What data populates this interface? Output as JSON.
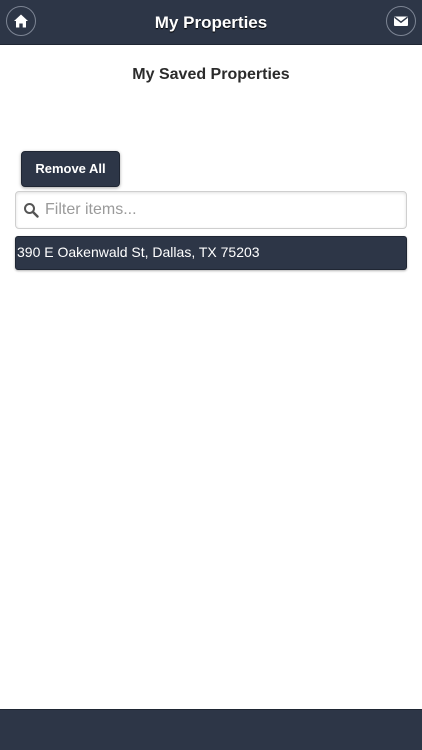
{
  "header": {
    "title": "My Properties",
    "left_icon": "home-icon",
    "right_icon": "mail-icon"
  },
  "main": {
    "heading": "My Saved Properties",
    "remove_all_label": "Remove All",
    "filter": {
      "placeholder": "Filter items...",
      "value": ""
    },
    "properties": [
      {
        "address": "390 E Oakenwald St, Dallas, TX 75203"
      }
    ]
  },
  "colors": {
    "bar": "#2d3647",
    "text_on_bar": "#ffffff",
    "background": "#ffffff"
  }
}
